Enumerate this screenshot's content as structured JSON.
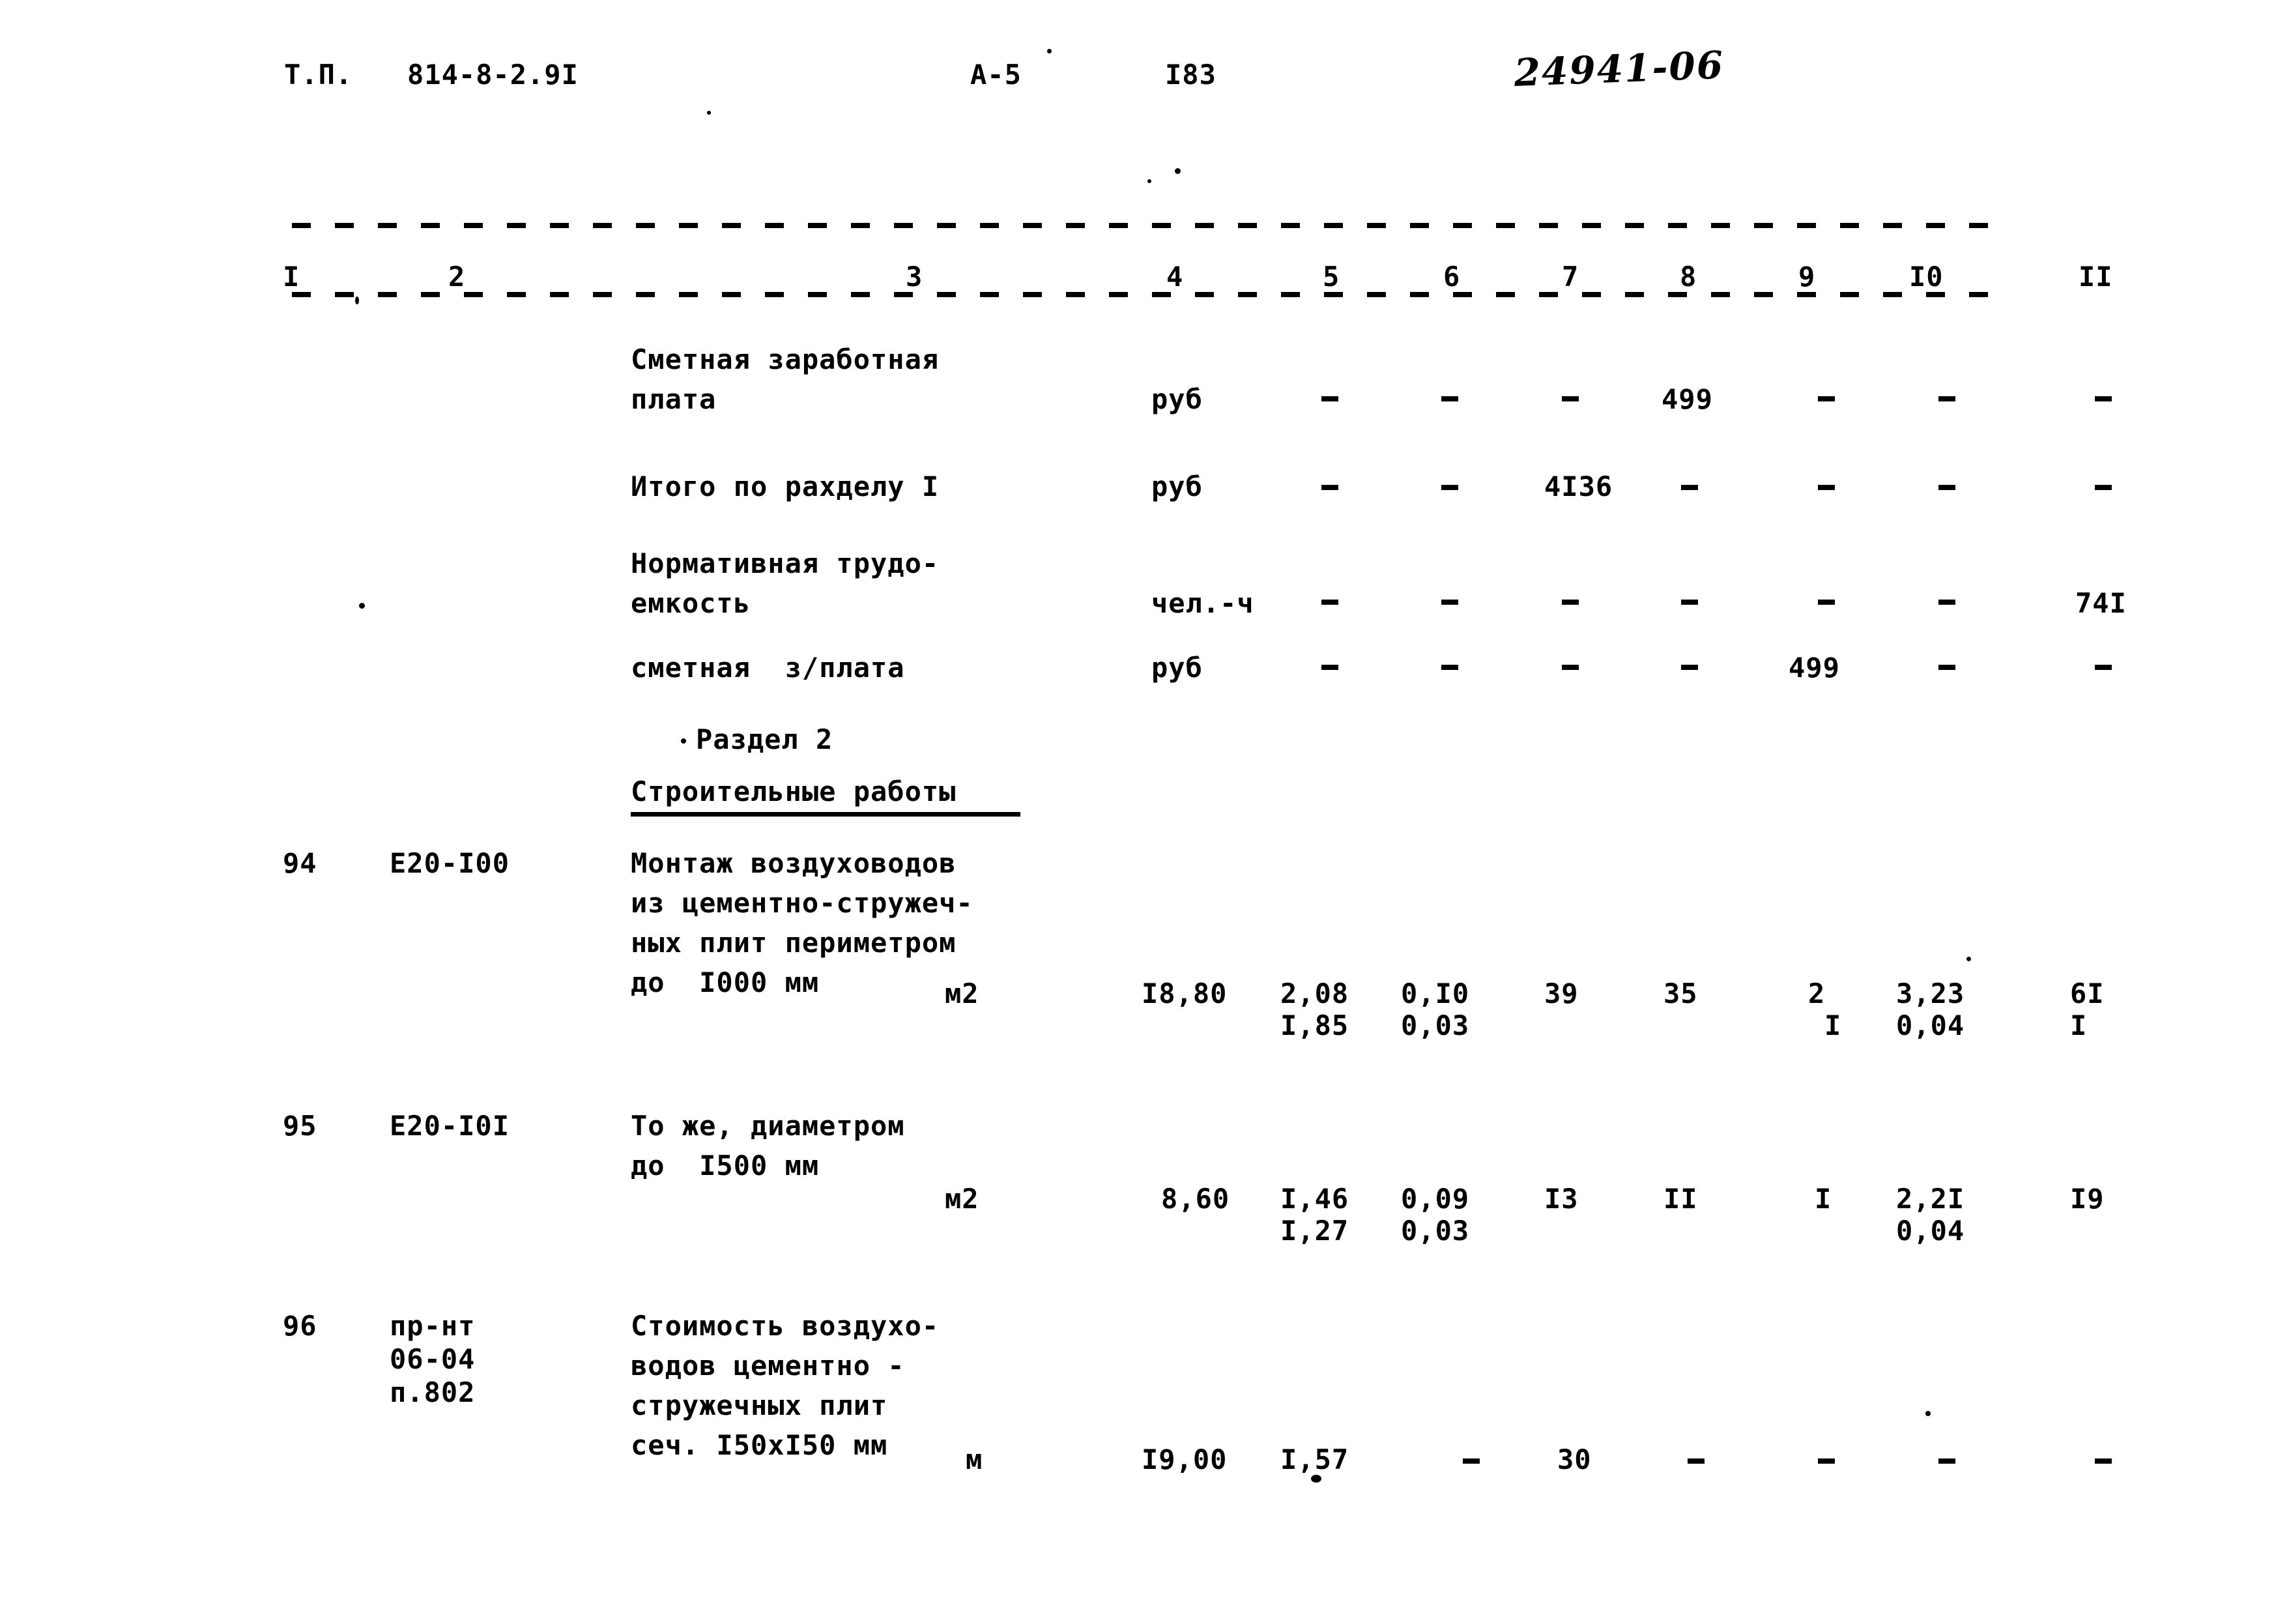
{
  "document": {
    "type_label": "Т.П.",
    "project_code": "814-8-2.9I",
    "sheet_code": "А-5",
    "page_number": "I83",
    "handwritten_stamp": "24941-06"
  },
  "table": {
    "column_headers": [
      "I",
      "2",
      "3",
      "4",
      "5",
      "6",
      "7",
      "8",
      "9",
      "I0",
      "II"
    ],
    "rows": [
      {
        "id": "row-smetnaya-zarplata",
        "num": "",
        "code": "",
        "desc_lines": [
          "Сметная заработная",
          "плата"
        ],
        "unit": "руб",
        "c4": "",
        "c5": "–",
        "c6": "–",
        "c7": "–",
        "c8": "499",
        "c9": "–",
        "c10": "–",
        "c11": "–",
        "c5b": "",
        "c6b": "",
        "c7b": "",
        "c8b": "",
        "c9b": "",
        "c10b": "",
        "c11b": ""
      },
      {
        "id": "row-itogo-razdel-1",
        "num": "",
        "code": "",
        "desc_lines": [
          "Итого по рахделу I"
        ],
        "unit": "руб",
        "c4": "",
        "c5": "–",
        "c6": "–",
        "c7": "4I36",
        "c8": "–",
        "c9": "–",
        "c10": "–",
        "c11": "–",
        "c5b": "",
        "c6b": "",
        "c7b": "",
        "c8b": "",
        "c9b": "",
        "c10b": "",
        "c11b": ""
      },
      {
        "id": "row-normativnaya-trudoemkost",
        "num": "",
        "code": "",
        "desc_lines": [
          "Нормативная трудо-",
          "емкость"
        ],
        "unit": "чел.-ч",
        "c4": "",
        "c5": "–",
        "c6": "–",
        "c7": "–",
        "c8": "–",
        "c9": "–",
        "c10": "–",
        "c11": "74I",
        "c5b": "",
        "c6b": "",
        "c7b": "",
        "c8b": "",
        "c9b": "",
        "c10b": "",
        "c11b": ""
      },
      {
        "id": "row-smetnaya-zplata",
        "num": "",
        "code": "",
        "desc_lines": [
          "сметная  з/плата"
        ],
        "unit": "руб",
        "c4": "",
        "c5": "–",
        "c6": "–",
        "c7": "–",
        "c8": "–",
        "c9": "499",
        "c10": "–",
        "c11": "–",
        "c5b": "",
        "c6b": "",
        "c7b": "",
        "c8b": "",
        "c9b": "",
        "c10b": "",
        "c11b": ""
      },
      {
        "id": "row-94",
        "num": "94",
        "code": "Е20-I00",
        "desc_lines": [
          "Монтаж воздуховодов",
          "из цементно-стружеч-",
          "ных плит периметром",
          "до  I000 мм"
        ],
        "unit": "м2",
        "c4": "I8,80",
        "c5": "2,08",
        "c6": "0,I0",
        "c7": "39",
        "c8": "35",
        "c9": "2",
        "c10": "3,23",
        "c11": "6I",
        "c5b": "I,85",
        "c6b": "0,03",
        "c7b": "",
        "c8b": "",
        "c9b": "I",
        "c10b": "0,04",
        "c11b": "I"
      },
      {
        "id": "row-95",
        "num": "95",
        "code": "Е20-I0I",
        "desc_lines": [
          "То же, диаметром",
          "до  I500 мм"
        ],
        "unit": "м2",
        "c4": "8,60",
        "c5": "I,46",
        "c6": "0,09",
        "c7": "I3",
        "c8": "II",
        "c9": "I",
        "c10": "2,2I",
        "c11": "I9",
        "c5b": "I,27",
        "c6b": "0,03",
        "c7b": "",
        "c8b": "",
        "c9b": "",
        "c10b": "0,04",
        "c11b": ""
      },
      {
        "id": "row-96",
        "num": "96",
        "code_lines": [
          "пр-нт",
          "06-04",
          "п.802"
        ],
        "code": "пр-нт",
        "desc_lines": [
          "Стоимость воздухо-",
          "водов цементно -",
          "стружечных плит",
          "сеч. I50хI50 мм"
        ],
        "unit": "м",
        "c4": "I9,00",
        "c5": "I,57",
        "c6": "–",
        "c7": "30",
        "c8": "–",
        "c9": "–",
        "c10": "–",
        "c11": "–",
        "c5b": "",
        "c6b": "",
        "c7b": "",
        "c8b": "",
        "c9b": "",
        "c10b": "",
        "c11b": ""
      }
    ],
    "section": {
      "title": "Раздел 2",
      "subtitle": "Строительные работы"
    }
  }
}
